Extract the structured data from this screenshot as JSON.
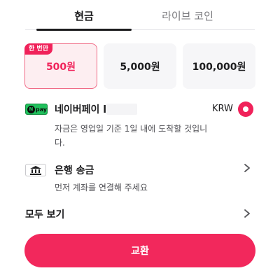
{
  "tabs": [
    {
      "label": "현금",
      "active": true
    },
    {
      "label": "라이브 코인",
      "active": false
    }
  ],
  "amounts": [
    {
      "label": "500원",
      "badge": "한 번만",
      "selected": true
    },
    {
      "label": "5,000원",
      "selected": false
    },
    {
      "label": "100,000원",
      "selected": false
    }
  ],
  "naver_pay": {
    "icon_text": "N",
    "icon_pay": "pay",
    "title": "네이버페이 l",
    "currency": "KRW",
    "selected": true,
    "description": "자금은 영업일 기준 1일 내에 도착할 것입니다."
  },
  "bank": {
    "title": "은행 송금",
    "description": "먼저 계좌를 연결해 주세요"
  },
  "all": {
    "title": "모두 보기"
  },
  "exchange_button": "교환",
  "colors": {
    "accent": "#f2285c",
    "naver_green": "#20c05c",
    "selected_card_bg": "#fdeef1"
  }
}
